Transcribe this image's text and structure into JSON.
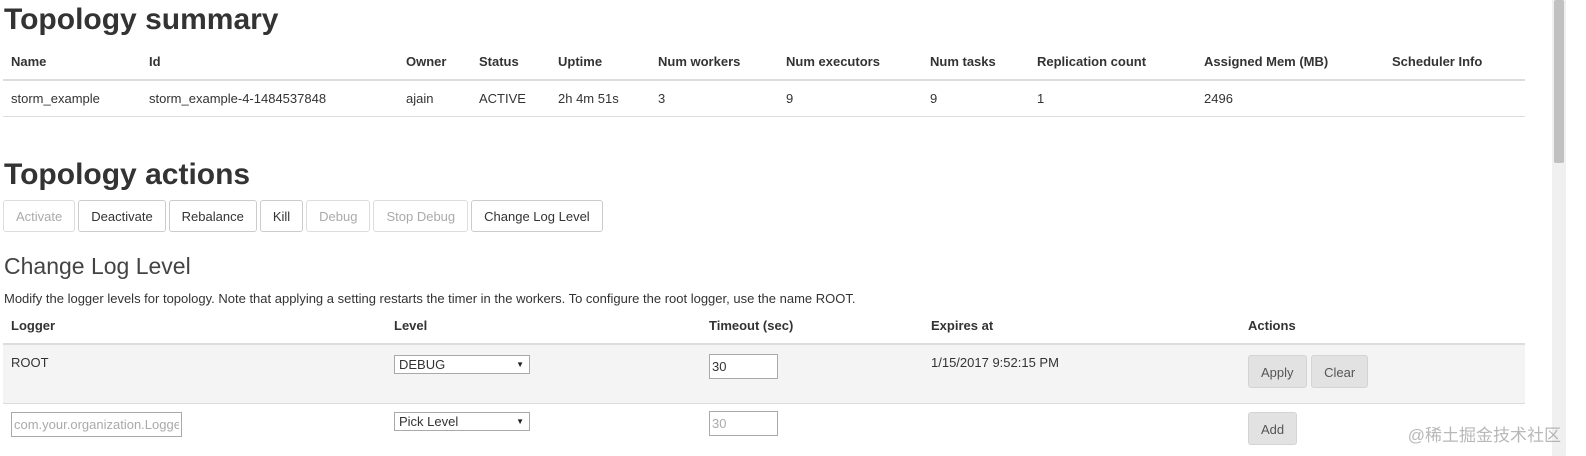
{
  "summary": {
    "title": "Topology summary",
    "headers": [
      "Name",
      "Id",
      "Owner",
      "Status",
      "Uptime",
      "Num workers",
      "Num executors",
      "Num tasks",
      "Replication count",
      "Assigned Mem (MB)",
      "Scheduler Info"
    ],
    "row": [
      "storm_example",
      "storm_example-4-1484537848",
      "ajain",
      "ACTIVE",
      "2h 4m 51s",
      "3",
      "9",
      "9",
      "1",
      "2496",
      ""
    ]
  },
  "actions": {
    "title": "Topology actions",
    "buttons": {
      "activate": "Activate",
      "deactivate": "Deactivate",
      "rebalance": "Rebalance",
      "kill": "Kill",
      "debug": "Debug",
      "stop_debug": "Stop Debug",
      "change_log_level": "Change Log Level"
    }
  },
  "log_level": {
    "title": "Change Log Level",
    "description": "Modify the logger levels for topology. Note that applying a setting restarts the timer in the workers. To configure the root logger, use the name ROOT.",
    "headers": [
      "Logger",
      "Level",
      "Timeout (sec)",
      "Expires at",
      "Actions"
    ],
    "root_row": {
      "logger": "ROOT",
      "level": "DEBUG",
      "timeout": "30",
      "expires_at": "1/15/2017 9:52:15 PM",
      "apply_label": "Apply",
      "clear_label": "Clear"
    },
    "new_row": {
      "logger_placeholder": "com.your.organization.LoggerName",
      "level": "Pick Level",
      "timeout_placeholder": "30",
      "add_label": "Add"
    }
  },
  "watermark": "@稀土掘金技术社区",
  "icons": {
    "select_caret": "▼"
  }
}
